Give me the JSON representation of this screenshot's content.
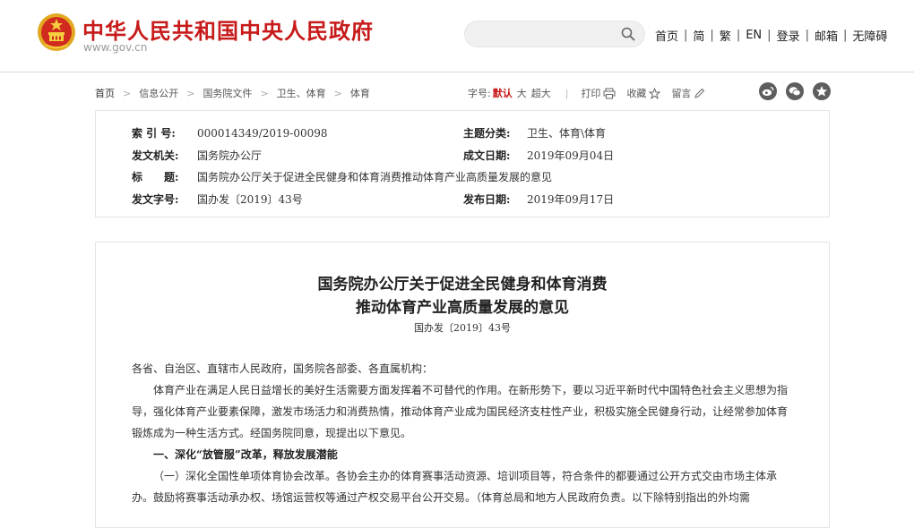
{
  "header": {
    "site_title": "中华人民共和国中央人民政府",
    "site_domain": "www.gov.cn",
    "search_placeholder": "",
    "nav": [
      "首页",
      "简",
      "繁",
      "EN",
      "登录",
      "邮箱",
      "无障碍"
    ],
    "nav_separator": "|"
  },
  "breadcrumb": {
    "items": [
      "首页",
      "信息公开",
      "国务院文件",
      "卫生、体育",
      "体育"
    ],
    "arrow": ">"
  },
  "toolbar": {
    "font_size_label": "字号:",
    "font_sizes": [
      "默认",
      "大",
      "超大"
    ],
    "active_size": "默认",
    "divider": "|",
    "print_label": "打印",
    "favorite_label": "收藏",
    "comment_label": "留言"
  },
  "share_icons": [
    "weibo-icon",
    "wechat-icon",
    "qzone-icon"
  ],
  "meta": {
    "index_label": "索 引 号:",
    "index_value": "000014349/2019-00098",
    "topic_label": "主题分类:",
    "topic_value": "卫生、体育\\体育",
    "issuer_label": "发文机关:",
    "issuer_value": "国务院办公厅",
    "written_label": "成文日期:",
    "written_value": "2019年09月04日",
    "title_label": "标　　题:",
    "title_value": "国务院办公厅关于促进全民健身和体育消费推动体育产业高质量发展的意见",
    "docno_label": "发文字号:",
    "docno_value": "国办发〔2019〕43号",
    "published_label": "发布日期:",
    "published_value": "2019年09月17日"
  },
  "article": {
    "title_line1": "国务院办公厅关于促进全民健身和体育消费",
    "title_line2": "推动体育产业高质量发展的意见",
    "doc_number": "国办发〔2019〕43号",
    "salutation": "各省、自治区、直辖市人民政府，国务院各部委、各直属机构：",
    "para1": "体育产业在满足人民日益增长的美好生活需要方面发挥着不可替代的作用。在新形势下，要以习近平新时代中国特色社会主义思想为指导，强化体育产业要素保障，激发市场活力和消费热情，推动体育产业成为国民经济支柱性产业，积极实施全民健身行动，让经常参加体育锻炼成为一种生活方式。经国务院同意，现提出以下意见。",
    "section1": "一、深化“放管服”改革，释放发展潜能",
    "para2": "（一）深化全国性单项体育协会改革。各协会主办的体育赛事活动资源、培训项目等，符合条件的都要通过公开方式交由市场主体承办。鼓励将赛事活动承办权、场馆运营权等通过产权交易平台公开交易。（体育总局和地方人民政府负责。以下除特别指出的外均需"
  },
  "colors": {
    "brand_red": "#c71a1a",
    "share_gray": "#5e5e5e"
  }
}
